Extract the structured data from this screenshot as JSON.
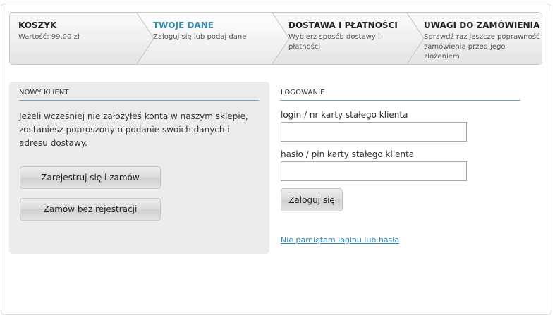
{
  "steps": [
    {
      "title": "KOSZYK",
      "desc": "Wartość: 99,00 zł"
    },
    {
      "title": "TWOJE DANE",
      "desc": "Zaloguj się lub podaj dane"
    },
    {
      "title": "DOSTAWA I PŁATNOŚCI",
      "desc": "Wybierz sposób dostawy i płatności"
    },
    {
      "title": "UWAGI DO ZAMÓWIENIA",
      "desc": "Sprawdź raz jeszcze poprawność zamówienia przed jego złożeniem"
    }
  ],
  "new_client": {
    "title": "NOWY KLIENT",
    "intro": "Jeżeli wcześniej nie założyłeś konta w naszym sklepie, zostaniesz poproszony o podanie swoich danych i adresu dostawy.",
    "register_button": "Zarejestruj się i zamów",
    "guest_button": "Zamów bez rejestracji"
  },
  "login": {
    "title": "LOGOWANIE",
    "login_label": "login / nr karty stałego klienta",
    "login_value": "",
    "password_label": "hasło / pin karty stałego klienta",
    "password_value": "",
    "submit_button": "Zaloguj się",
    "forgot_link": "Nie pamiętam loginu lub hasła"
  },
  "colors": {
    "accent": "#3a8dae",
    "link": "#2e86b8",
    "panel_bg": "#ececec",
    "rule": "#6aa6c8"
  }
}
